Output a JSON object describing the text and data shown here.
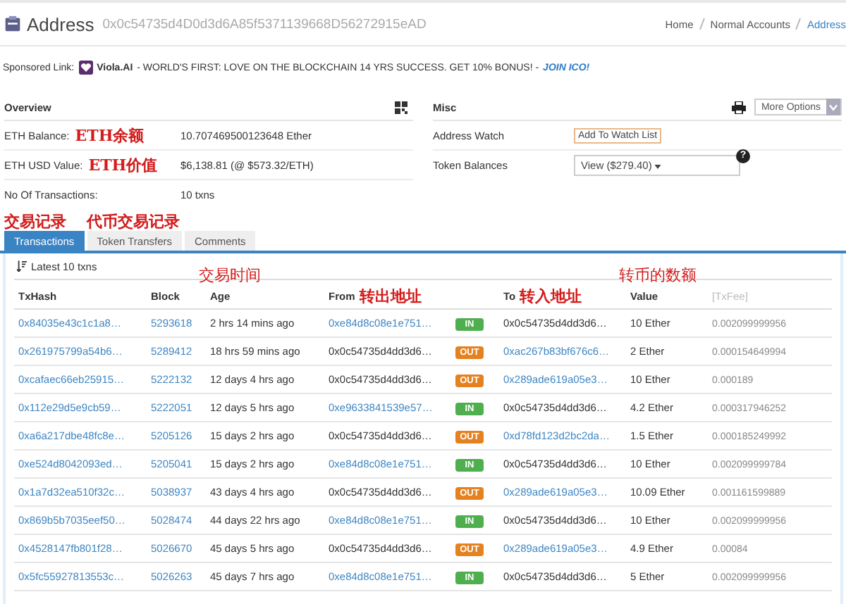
{
  "header": {
    "title": "Address",
    "address": "0x0c54735d4D0d3d6A85f5371139668D56272915eAD",
    "breadcrumbs": [
      {
        "label": "Home",
        "selected": false
      },
      {
        "label": "Normal Accounts",
        "selected": false
      },
      {
        "label": "Address",
        "selected": true
      }
    ]
  },
  "sponsored": {
    "label": "Sponsored Link:",
    "brand": "Viola.AI",
    "text": "- WORLD'S FIRST: LOVE ON THE BLOCKCHAIN  14 YRS SUCCESS. GET 10% BONUS! -",
    "link": "JOIN ICO!"
  },
  "overview": {
    "title": "Overview",
    "rows": [
      {
        "label": "ETH Balance:",
        "annotation": "ETH余额",
        "value": "10.707469500123648 Ether"
      },
      {
        "label": "ETH USD Value:",
        "annotation": "ETH价值",
        "value": "$6,138.81 (@ $573.32/ETH)"
      },
      {
        "label": "No Of Transactions:",
        "value": "10 txns"
      }
    ]
  },
  "misc": {
    "title": "Misc",
    "more_options": "More Options",
    "rows": [
      {
        "label": "Address Watch",
        "kind": "button",
        "value": "Add To Watch List"
      },
      {
        "label": "Token Balances",
        "kind": "dropdown",
        "value": "View ($279.40)",
        "help": "?"
      }
    ]
  },
  "tabs": [
    {
      "label": "Transactions",
      "annotation": "交易记录",
      "selected": true
    },
    {
      "label": "Token Transfers",
      "annotation": "代币交易记录",
      "selected": false
    },
    {
      "label": "Comments",
      "selected": false
    }
  ],
  "table": {
    "caption": "Latest 10 txns",
    "columns": [
      {
        "label": "TxHash"
      },
      {
        "label": "Block"
      },
      {
        "label": "Age",
        "annotation": "交易时间",
        "annotation_above": true
      },
      {
        "label": "From",
        "annotation": "转出地址",
        "annotation_above": false
      },
      {
        "label": "To",
        "annotation": "转入地址",
        "annotation_above": false
      },
      {
        "label": "Value",
        "annotation": "转币的数额",
        "annotation_above": true
      },
      {
        "label": "[TxFee]"
      }
    ],
    "rows": [
      {
        "hash": "0x84035e43c1c1a8…",
        "block": "5293618",
        "age": "2 hrs 14 mins ago",
        "from": "0xe84d8c08e1e751…",
        "from_link": true,
        "direction": "IN",
        "to": "0x0c54735d4dd3d6…",
        "to_link": false,
        "value": "10 Ether",
        "fee": "0.002099999956"
      },
      {
        "hash": "0x261975799a54b6…",
        "block": "5289412",
        "age": "18 hrs 59 mins ago",
        "from": "0x0c54735d4dd3d6…",
        "from_link": false,
        "direction": "OUT",
        "to": "0xac267b83bf676c6…",
        "to_link": true,
        "value": "2 Ether",
        "fee": "0.000154649994"
      },
      {
        "hash": "0xcafaec66eb25915…",
        "block": "5222132",
        "age": "12 days 4 hrs ago",
        "from": "0x0c54735d4dd3d6…",
        "from_link": false,
        "direction": "OUT",
        "to": "0x289ade619a05e3…",
        "to_link": true,
        "value": "10 Ether",
        "fee": "0.000189"
      },
      {
        "hash": "0x112e29d5e9cb59…",
        "block": "5222051",
        "age": "12 days 5 hrs ago",
        "from": "0xe9633841539e57…",
        "from_link": true,
        "direction": "IN",
        "to": "0x0c54735d4dd3d6…",
        "to_link": false,
        "value": "4.2 Ether",
        "fee": "0.000317946252"
      },
      {
        "hash": "0xa6a217dbe48fc8e…",
        "block": "5205126",
        "age": "15 days 2 hrs ago",
        "from": "0x0c54735d4dd3d6…",
        "from_link": false,
        "direction": "OUT",
        "to": "0xd78fd123d2bc2da…",
        "to_link": true,
        "value": "1.5 Ether",
        "fee": "0.000185249992"
      },
      {
        "hash": "0xe524d8042093ed…",
        "block": "5205041",
        "age": "15 days 2 hrs ago",
        "from": "0xe84d8c08e1e751…",
        "from_link": true,
        "direction": "IN",
        "to": "0x0c54735d4dd3d6…",
        "to_link": false,
        "value": "10 Ether",
        "fee": "0.002099999784"
      },
      {
        "hash": "0x1a7d32ea510f32c…",
        "block": "5038937",
        "age": "43 days 4 hrs ago",
        "from": "0x0c54735d4dd3d6…",
        "from_link": false,
        "direction": "OUT",
        "to": "0x289ade619a05e3…",
        "to_link": true,
        "value": "10.09 Ether",
        "fee": "0.001161599889"
      },
      {
        "hash": "0x869b5b7035eef50…",
        "block": "5028474",
        "age": "44 days 22 hrs ago",
        "from": "0xe84d8c08e1e751…",
        "from_link": true,
        "direction": "IN",
        "to": "0x0c54735d4dd3d6…",
        "to_link": false,
        "value": "10 Ether",
        "fee": "0.002099999956"
      },
      {
        "hash": "0x4528147fb801f28…",
        "block": "5026670",
        "age": "45 days 5 hrs ago",
        "from": "0x0c54735d4dd3d6…",
        "from_link": false,
        "direction": "OUT",
        "to": "0x289ade619a05e3…",
        "to_link": true,
        "value": "4.9 Ether",
        "fee": "0.00084"
      },
      {
        "hash": "0x5fc55927813553c…",
        "block": "5026263",
        "age": "45 days 7 hrs ago",
        "from": "0xe84d8c08e1e751…",
        "from_link": true,
        "direction": "IN",
        "to": "0x0c54735d4dd3d6…",
        "to_link": false,
        "value": "5 Ether",
        "fee": "0.002099999956"
      }
    ]
  }
}
